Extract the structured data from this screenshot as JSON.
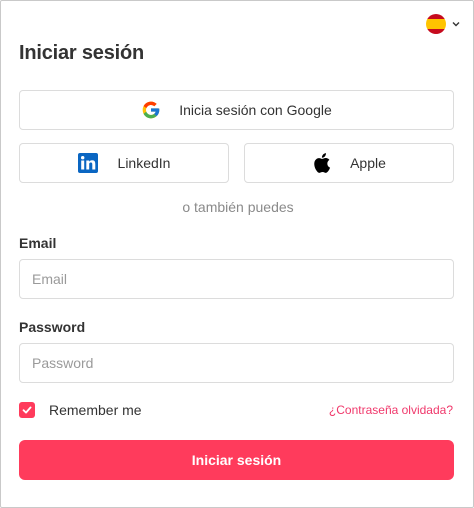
{
  "language": {
    "flag_icon": "spain-flag-icon",
    "chevron_icon": "chevron-down-icon"
  },
  "header": {
    "title": "Iniciar sesión"
  },
  "social": {
    "google_label": "Inicia sesión con Google",
    "linkedin_label": "LinkedIn",
    "apple_label": "Apple",
    "divider_text": "o también puedes"
  },
  "form": {
    "email_label": "Email",
    "email_placeholder": "Email",
    "email_value": "",
    "password_label": "Password",
    "password_placeholder": "Password",
    "password_value": "",
    "remember_label": "Remember me",
    "remember_checked": true,
    "forgot_link": "¿Contraseña olvidada?",
    "submit_label": "Iniciar sesión"
  },
  "colors": {
    "accent": "#ff3b5c",
    "link": "#f0386b",
    "border": "#dcdcdc",
    "linkedin": "#0a66c2"
  }
}
